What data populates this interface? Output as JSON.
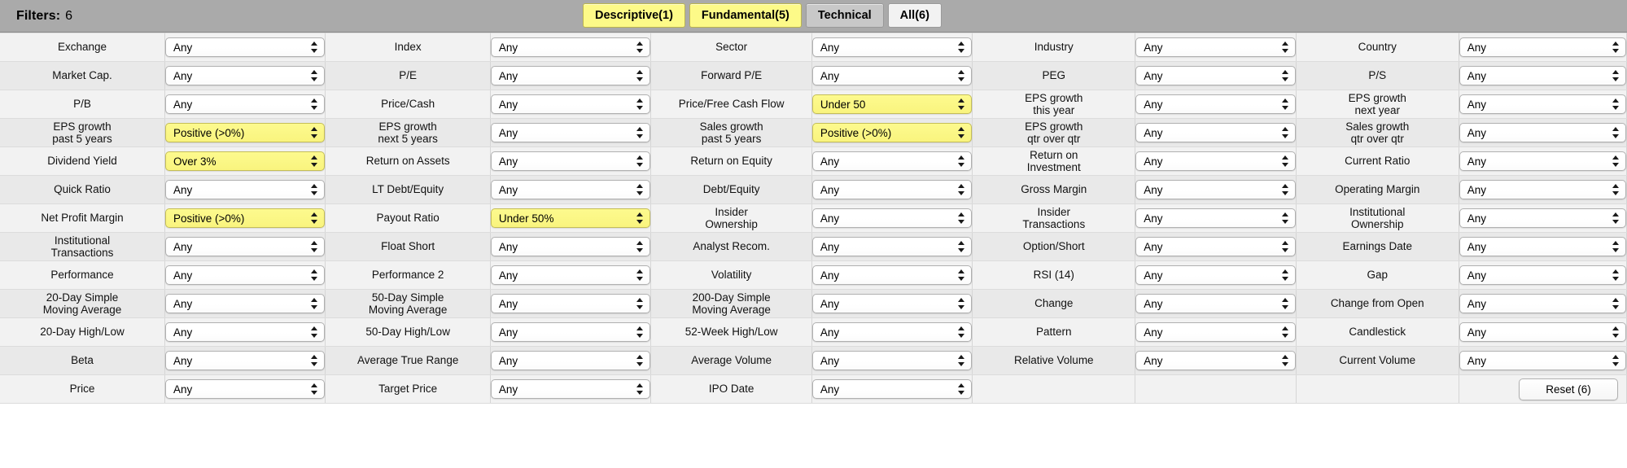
{
  "header": {
    "filters_label": "Filters:",
    "filters_count": "6",
    "tabs": [
      {
        "label": "Descriptive(1)",
        "state": "highlight"
      },
      {
        "label": "Fundamental(5)",
        "state": "highlight"
      },
      {
        "label": "Technical",
        "state": "normal"
      },
      {
        "label": "All(6)",
        "state": "active"
      }
    ]
  },
  "reset": {
    "label": "Reset (6)"
  },
  "default_value": "Any",
  "rows": [
    [
      {
        "label": "Exchange",
        "value": "Any",
        "active": false
      },
      {
        "label": "Index",
        "value": "Any",
        "active": false
      },
      {
        "label": "Sector",
        "value": "Any",
        "active": false
      },
      {
        "label": "Industry",
        "value": "Any",
        "active": false
      },
      {
        "label": "Country",
        "value": "Any",
        "active": false
      }
    ],
    [
      {
        "label": "Market Cap.",
        "value": "Any",
        "active": false
      },
      {
        "label": "P/E",
        "value": "Any",
        "active": false
      },
      {
        "label": "Forward P/E",
        "value": "Any",
        "active": false
      },
      {
        "label": "PEG",
        "value": "Any",
        "active": false
      },
      {
        "label": "P/S",
        "value": "Any",
        "active": false
      }
    ],
    [
      {
        "label": "P/B",
        "value": "Any",
        "active": false
      },
      {
        "label": "Price/Cash",
        "value": "Any",
        "active": false
      },
      {
        "label": "Price/Free Cash Flow",
        "value": "Under 50",
        "active": true
      },
      {
        "label": "EPS growth\nthis year",
        "value": "Any",
        "active": false
      },
      {
        "label": "EPS growth\nnext year",
        "value": "Any",
        "active": false
      }
    ],
    [
      {
        "label": "EPS growth\npast 5 years",
        "value": "Positive (>0%)",
        "active": true
      },
      {
        "label": "EPS growth\nnext 5 years",
        "value": "Any",
        "active": false
      },
      {
        "label": "Sales growth\npast 5 years",
        "value": "Positive (>0%)",
        "active": true
      },
      {
        "label": "EPS growth\nqtr over qtr",
        "value": "Any",
        "active": false
      },
      {
        "label": "Sales growth\nqtr over qtr",
        "value": "Any",
        "active": false
      }
    ],
    [
      {
        "label": "Dividend Yield",
        "value": "Over 3%",
        "active": true
      },
      {
        "label": "Return on Assets",
        "value": "Any",
        "active": false
      },
      {
        "label": "Return on Equity",
        "value": "Any",
        "active": false
      },
      {
        "label": "Return on\nInvestment",
        "value": "Any",
        "active": false
      },
      {
        "label": "Current Ratio",
        "value": "Any",
        "active": false
      }
    ],
    [
      {
        "label": "Quick Ratio",
        "value": "Any",
        "active": false
      },
      {
        "label": "LT Debt/Equity",
        "value": "Any",
        "active": false
      },
      {
        "label": "Debt/Equity",
        "value": "Any",
        "active": false
      },
      {
        "label": "Gross Margin",
        "value": "Any",
        "active": false
      },
      {
        "label": "Operating Margin",
        "value": "Any",
        "active": false
      }
    ],
    [
      {
        "label": "Net Profit Margin",
        "value": "Positive (>0%)",
        "active": true
      },
      {
        "label": "Payout Ratio",
        "value": "Under 50%",
        "active": true
      },
      {
        "label": "Insider\nOwnership",
        "value": "Any",
        "active": false
      },
      {
        "label": "Insider\nTransactions",
        "value": "Any",
        "active": false
      },
      {
        "label": "Institutional\nOwnership",
        "value": "Any",
        "active": false
      }
    ],
    [
      {
        "label": "Institutional\nTransactions",
        "value": "Any",
        "active": false
      },
      {
        "label": "Float Short",
        "value": "Any",
        "active": false
      },
      {
        "label": "Analyst Recom.",
        "value": "Any",
        "active": false
      },
      {
        "label": "Option/Short",
        "value": "Any",
        "active": false
      },
      {
        "label": "Earnings Date",
        "value": "Any",
        "active": false
      }
    ],
    [
      {
        "label": "Performance",
        "value": "Any",
        "active": false
      },
      {
        "label": "Performance 2",
        "value": "Any",
        "active": false
      },
      {
        "label": "Volatility",
        "value": "Any",
        "active": false
      },
      {
        "label": "RSI (14)",
        "value": "Any",
        "active": false
      },
      {
        "label": "Gap",
        "value": "Any",
        "active": false
      }
    ],
    [
      {
        "label": "20-Day Simple\nMoving Average",
        "value": "Any",
        "active": false
      },
      {
        "label": "50-Day Simple\nMoving Average",
        "value": "Any",
        "active": false
      },
      {
        "label": "200-Day Simple\nMoving Average",
        "value": "Any",
        "active": false
      },
      {
        "label": "Change",
        "value": "Any",
        "active": false
      },
      {
        "label": "Change from Open",
        "value": "Any",
        "active": false
      }
    ],
    [
      {
        "label": "20-Day High/Low",
        "value": "Any",
        "active": false
      },
      {
        "label": "50-Day High/Low",
        "value": "Any",
        "active": false
      },
      {
        "label": "52-Week High/Low",
        "value": "Any",
        "active": false
      },
      {
        "label": "Pattern",
        "value": "Any",
        "active": false
      },
      {
        "label": "Candlestick",
        "value": "Any",
        "active": false
      }
    ],
    [
      {
        "label": "Beta",
        "value": "Any",
        "active": false
      },
      {
        "label": "Average True Range",
        "value": "Any",
        "active": false
      },
      {
        "label": "Average Volume",
        "value": "Any",
        "active": false
      },
      {
        "label": "Relative Volume",
        "value": "Any",
        "active": false
      },
      {
        "label": "Current Volume",
        "value": "Any",
        "active": false
      }
    ],
    [
      {
        "label": "Price",
        "value": "Any",
        "active": false
      },
      {
        "label": "Target Price",
        "value": "Any",
        "active": false
      },
      {
        "label": "IPO Date",
        "value": "Any",
        "active": false
      },
      {
        "label": "",
        "value": null,
        "active": false
      },
      {
        "label": "",
        "value": null,
        "active": false,
        "reset": true
      }
    ]
  ]
}
